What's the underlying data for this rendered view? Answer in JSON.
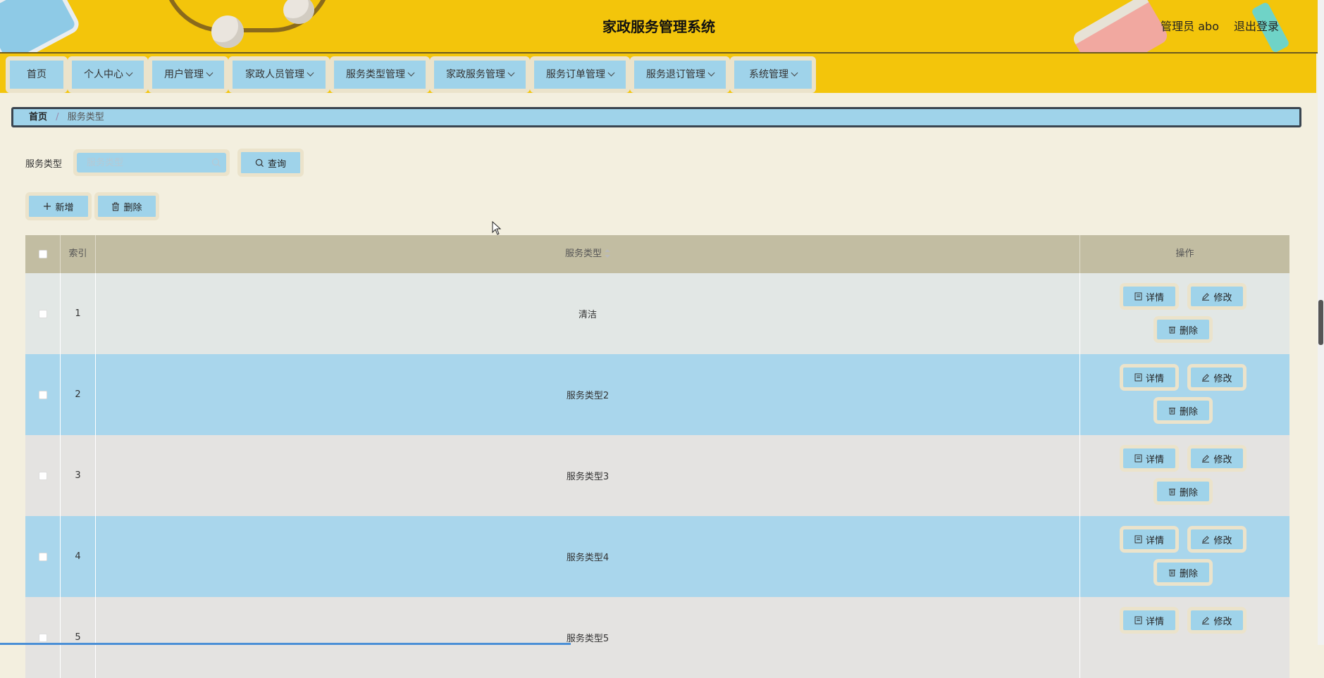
{
  "header": {
    "title": "家政服务管理系统",
    "user_label": "管理员 abo",
    "logout_label": "退出登录"
  },
  "nav": {
    "items": [
      {
        "label": "首页",
        "dropdown": false
      },
      {
        "label": "个人中心",
        "dropdown": true
      },
      {
        "label": "用户管理",
        "dropdown": true
      },
      {
        "label": "家政人员管理",
        "dropdown": true
      },
      {
        "label": "服务类型管理",
        "dropdown": true
      },
      {
        "label": "家政服务管理",
        "dropdown": true
      },
      {
        "label": "服务订单管理",
        "dropdown": true
      },
      {
        "label": "服务退订管理",
        "dropdown": true
      },
      {
        "label": "系统管理",
        "dropdown": true
      }
    ]
  },
  "breadcrumb": {
    "home": "首页",
    "separator": "/",
    "current": "服务类型"
  },
  "search": {
    "label": "服务类型",
    "placeholder": "服务类型",
    "value": "",
    "button_label": "查询"
  },
  "actions": {
    "add_label": "新增",
    "delete_label": "删除"
  },
  "table": {
    "columns": {
      "index": "索引",
      "type": "服务类型",
      "ops": "操作"
    },
    "op_labels": {
      "detail": "详情",
      "edit": "修改",
      "delete": "删除"
    },
    "rows": [
      {
        "index": "1",
        "type": "清洁"
      },
      {
        "index": "2",
        "type": "服务类型2"
      },
      {
        "index": "3",
        "type": "服务类型3"
      },
      {
        "index": "4",
        "type": "服务类型4"
      },
      {
        "index": "5",
        "type": "服务类型5"
      }
    ]
  },
  "colors": {
    "header_bg": "#f3c50b",
    "button_bg": "#9fd3ea",
    "button_border": "#ebe3cb",
    "page_bg": "#f3efdf",
    "table_header_bg": "#c2bda2"
  }
}
